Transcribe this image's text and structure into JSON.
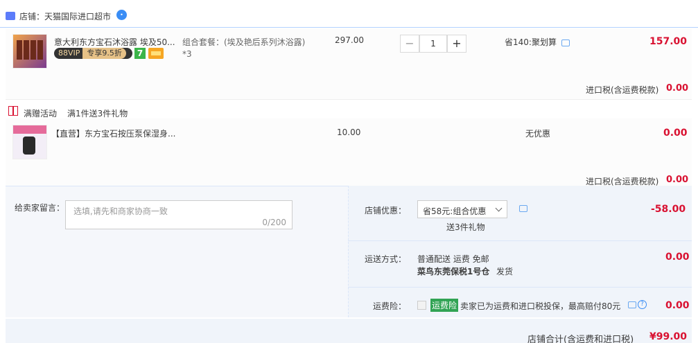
{
  "shop": {
    "label": "店铺：天猫国际进口超市"
  },
  "item1": {
    "title": "意大利东方宝石沐浴露 埃及50...",
    "vip_label": "88VIP",
    "vip_discount": "专享9.5折",
    "badge_seven": "7",
    "sku_label": "组合套餐：(埃及艳后系列沐浴露)",
    "sku_qty": "*3",
    "unit_price": "297.00",
    "quantity": "1",
    "promo": "省140:聚划算",
    "subtotal": "157.00",
    "tax_label": "进口税(含运费税款)",
    "tax_value": "0.00"
  },
  "gift_activity": {
    "label": "满赠活动",
    "desc": "满1件送3件礼物"
  },
  "item2": {
    "title": "【直营】东方宝石按压泵保湿身...",
    "unit_price": "10.00",
    "promo": "无优惠",
    "subtotal": "0.00",
    "tax_label": "进口税(含运费税款)",
    "tax_value": "0.00"
  },
  "message": {
    "label": "给卖家留言：",
    "placeholder": "选填,请先和商家协商一致",
    "counter": "0/200"
  },
  "shop_discount": {
    "label": "店铺优惠：",
    "selected": "省58元:组合优惠",
    "gift_note": "送3件礼物",
    "value": "-58.00"
  },
  "shipping": {
    "label": "运送方式：",
    "method": "普通配送 运费 免邮",
    "warehouse": "菜鸟东莞保税1号仓",
    "dispatch": "发货",
    "value": "0.00"
  },
  "insurance": {
    "label": "运费险：",
    "tag": "运费险",
    "desc": "卖家已为运费和进口税投保，最高赔付80元",
    "value": "0.00"
  },
  "footer": {
    "label": "店铺合计(含运费和进口税)",
    "total": "¥99.00"
  },
  "colors": {
    "accent_red": "#d91131",
    "link_blue": "#3a8df5",
    "ins_green": "#31a354"
  }
}
